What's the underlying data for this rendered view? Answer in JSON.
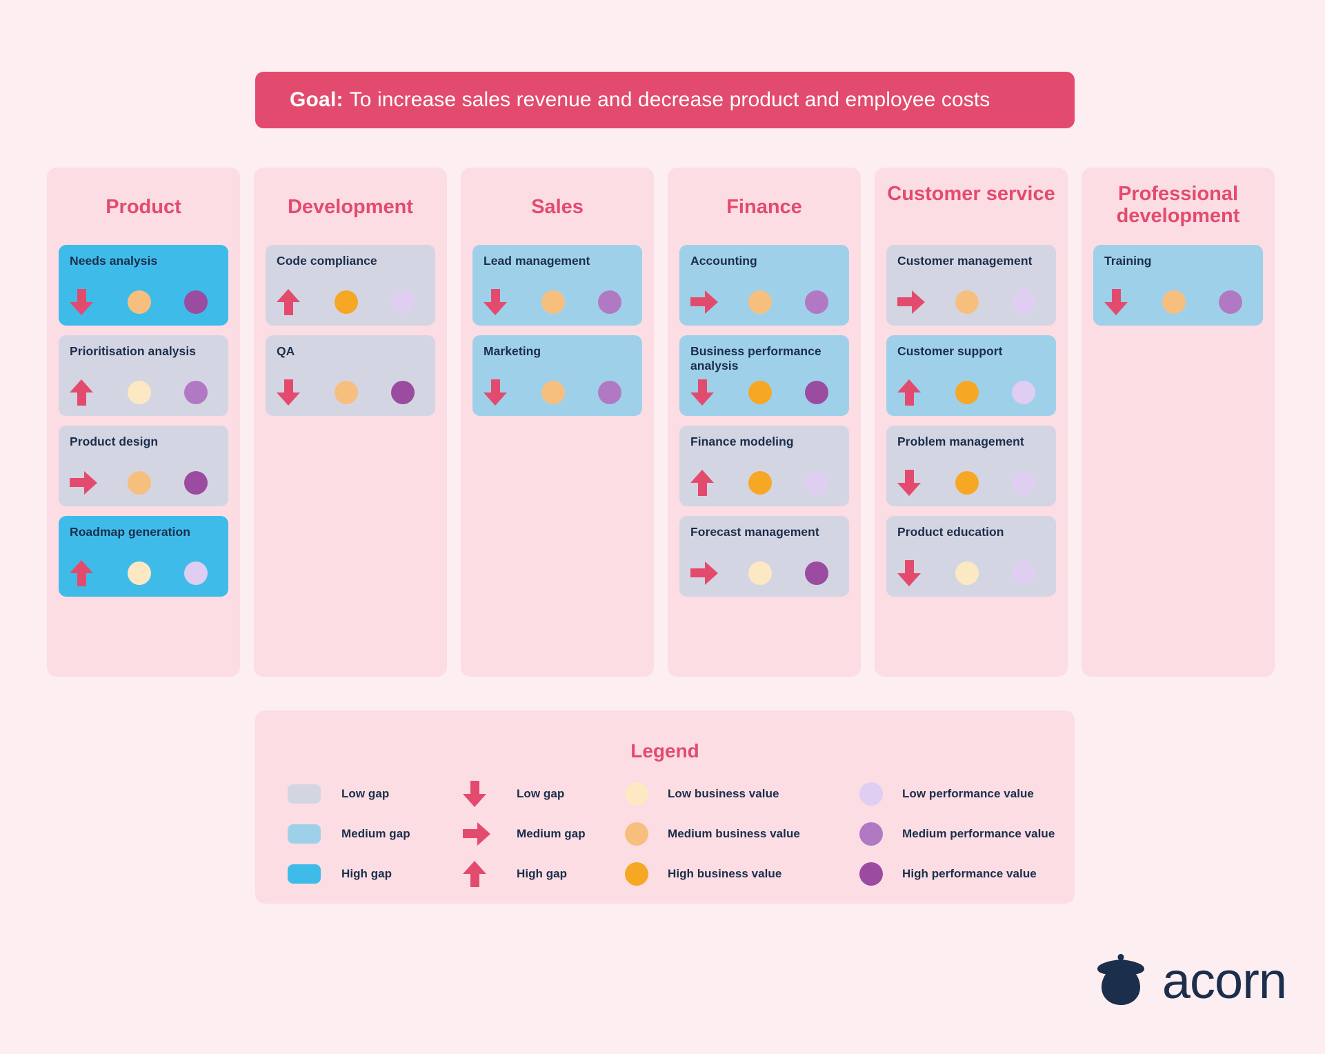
{
  "goal": {
    "label": "Goal:",
    "text": "To increase sales revenue and decrease product and employee costs"
  },
  "colors": {
    "page_background": "#fdeef1",
    "accent_pink": "#e34b6e",
    "column_background": "#fbdde3",
    "gap_low": "#d4d5e3",
    "gap_medium": "#9fd0ea",
    "gap_high": "#3fbbea",
    "business_low": "#fce9c4",
    "business_medium": "#f7bf7e",
    "business_high": "#f6a723",
    "performance_low": "#e0cdf2",
    "performance_medium": "#b179c4",
    "performance_high": "#9b4ba0",
    "text_dark": "#1b2e4b"
  },
  "columns": [
    {
      "title": "Product",
      "cards": [
        {
          "title": "Needs analysis",
          "gap": "high",
          "arrow": "down",
          "business": "medium",
          "performance": "high"
        },
        {
          "title": "Prioritisation analysis",
          "gap": "low",
          "arrow": "up",
          "business": "low",
          "performance": "medium"
        },
        {
          "title": "Product design",
          "gap": "low",
          "arrow": "right",
          "business": "medium",
          "performance": "high"
        },
        {
          "title": "Roadmap generation",
          "gap": "high",
          "arrow": "up",
          "business": "low",
          "performance": "low"
        }
      ]
    },
    {
      "title": "Development",
      "cards": [
        {
          "title": "Code compliance",
          "gap": "low",
          "arrow": "up",
          "business": "high",
          "performance": "low"
        },
        {
          "title": "QA",
          "gap": "low",
          "arrow": "down",
          "business": "medium",
          "performance": "high"
        }
      ]
    },
    {
      "title": "Sales",
      "cards": [
        {
          "title": "Lead management",
          "gap": "medium",
          "arrow": "down",
          "business": "medium",
          "performance": "medium"
        },
        {
          "title": "Marketing",
          "gap": "medium",
          "arrow": "down",
          "business": "medium",
          "performance": "medium"
        }
      ]
    },
    {
      "title": "Finance",
      "cards": [
        {
          "title": "Accounting",
          "gap": "medium",
          "arrow": "right",
          "business": "medium",
          "performance": "medium"
        },
        {
          "title": "Business performance analysis",
          "gap": "medium",
          "arrow": "down",
          "business": "high",
          "performance": "high"
        },
        {
          "title": "Finance modeling",
          "gap": "low",
          "arrow": "up",
          "business": "high",
          "performance": "low"
        },
        {
          "title": "Forecast management",
          "gap": "low",
          "arrow": "right",
          "business": "low",
          "performance": "high"
        }
      ]
    },
    {
      "title": "Customer service",
      "cards": [
        {
          "title": "Customer management",
          "gap": "low",
          "arrow": "right",
          "business": "medium",
          "performance": "low"
        },
        {
          "title": "Customer support",
          "gap": "medium",
          "arrow": "up",
          "business": "high",
          "performance": "low"
        },
        {
          "title": "Problem management",
          "gap": "low",
          "arrow": "down",
          "business": "high",
          "performance": "low"
        },
        {
          "title": "Product education",
          "gap": "low",
          "arrow": "down",
          "business": "low",
          "performance": "low"
        }
      ]
    },
    {
      "title": "Professional development",
      "cards": [
        {
          "title": "Training",
          "gap": "medium",
          "arrow": "down",
          "business": "medium",
          "performance": "medium"
        }
      ]
    }
  ],
  "legend": {
    "title": "Legend",
    "gap_swatches": [
      {
        "label": "Low gap",
        "level": "low"
      },
      {
        "label": "Medium gap",
        "level": "medium"
      },
      {
        "label": "High gap",
        "level": "high"
      }
    ],
    "gap_arrows": [
      {
        "label": "Low gap",
        "arrow": "down"
      },
      {
        "label": "Medium gap",
        "arrow": "right"
      },
      {
        "label": "High gap",
        "arrow": "up"
      }
    ],
    "business_values": [
      {
        "label": "Low business value",
        "level": "low"
      },
      {
        "label": "Medium business value",
        "level": "medium"
      },
      {
        "label": "High business value",
        "level": "high"
      }
    ],
    "performance_values": [
      {
        "label": "Low performance value",
        "level": "low"
      },
      {
        "label": "Medium performance value",
        "level": "medium"
      },
      {
        "label": "High performance value",
        "level": "high"
      }
    ]
  },
  "brand": {
    "name": "acorn"
  }
}
